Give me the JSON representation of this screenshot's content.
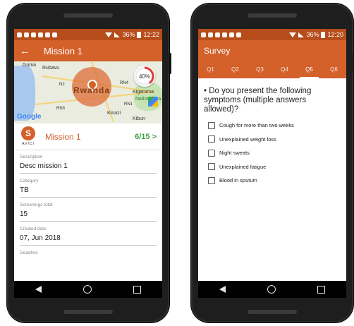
{
  "left_phone": {
    "status": {
      "battery": "36%",
      "time": "12:22"
    },
    "appbar": {
      "title": "Mission 1"
    },
    "map": {
      "labels": [
        "Goma",
        "Rubavu",
        "Rwanda",
        "Kigarama",
        "National Pa",
        "Kinazi",
        "Kibun"
      ],
      "road_labels": [
        "N2",
        "RN4",
        "RN3",
        "RN1"
      ],
      "progress": "40%",
      "progress_value": 0.4,
      "google": "Google"
    },
    "mission": {
      "logo_letter": "S",
      "logo_text": "AVICI",
      "name": "Mission 1",
      "count": "6/15 >"
    },
    "fields": [
      {
        "label": "Description",
        "value": "Desc mission 1"
      },
      {
        "label": "Category",
        "value": "TB"
      },
      {
        "label": "Screenings total",
        "value": "15"
      },
      {
        "label": "Created date",
        "value": "07, Jun 2018"
      },
      {
        "label": "Deadline",
        "value": ""
      }
    ]
  },
  "right_phone": {
    "status": {
      "battery": "36%",
      "time": "12:20"
    },
    "appbar": {
      "title": "Survey"
    },
    "tabs": [
      "Q1",
      "Q2",
      "Q3",
      "Q4",
      "Q5",
      "Q6"
    ],
    "active_tab": "Q5",
    "question": "• Do you present the following symptoms (multiple answers allowed)?",
    "options": [
      "Cough for more than two weeks",
      "Unexplained weight loss",
      "Night sweats",
      "Unexplained fatigue",
      "Blood in sputum"
    ]
  },
  "colors": {
    "primary": "#d4602a",
    "status_bar": "#b64d1a",
    "accent_green": "#43a047"
  }
}
